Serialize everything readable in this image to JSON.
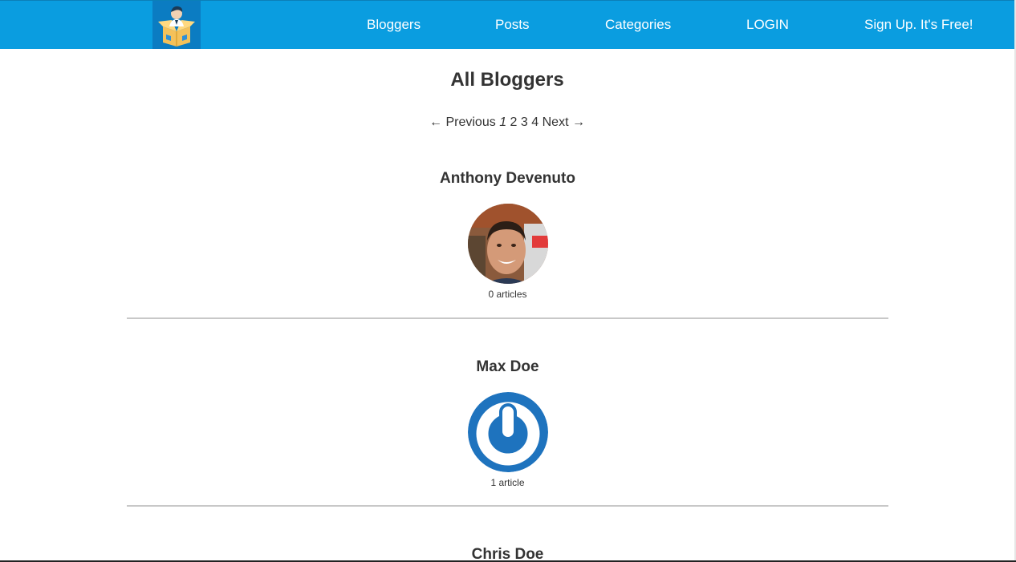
{
  "nav": {
    "links": [
      {
        "label": "Bloggers"
      },
      {
        "label": "Posts"
      },
      {
        "label": "Categories"
      },
      {
        "label": "LOGIN"
      },
      {
        "label": "Sign Up. It's Free!"
      }
    ],
    "brand_color": "#0a9de0",
    "logo_icon": "blogger-mascot-logo"
  },
  "main": {
    "title": "All Bloggers",
    "pagination": {
      "previous": "← Previous",
      "pages": [
        "1",
        "2",
        "3",
        "4"
      ],
      "current_page": "1",
      "next": "Next →"
    }
  },
  "bloggers": [
    {
      "name": "Anthony Devenuto",
      "articles": "0 articles",
      "avatar_icon": "profile-photo"
    },
    {
      "name": "Max Doe",
      "articles": "1 article",
      "avatar_icon": "gravatar-logo-icon"
    },
    {
      "name": "Chris Doe"
    }
  ]
}
